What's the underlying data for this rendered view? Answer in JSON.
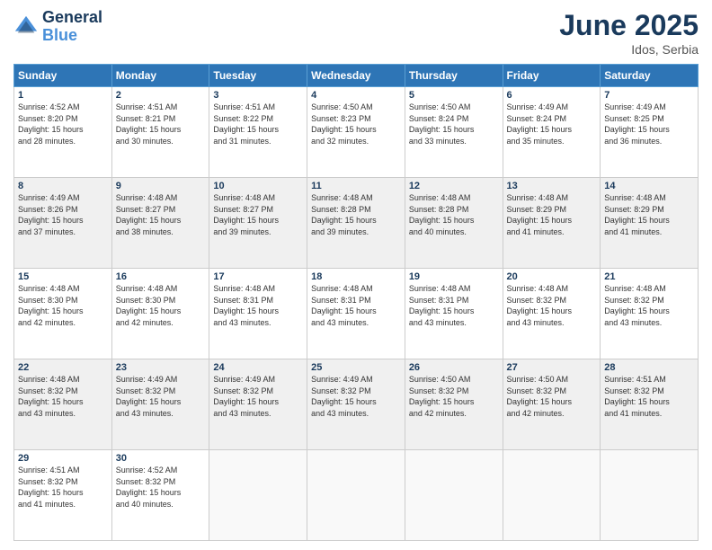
{
  "header": {
    "logo_line1": "General",
    "logo_line2": "Blue",
    "month_title": "June 2025",
    "location": "Idos, Serbia"
  },
  "days_of_week": [
    "Sunday",
    "Monday",
    "Tuesday",
    "Wednesday",
    "Thursday",
    "Friday",
    "Saturday"
  ],
  "weeks": [
    [
      {
        "day": "1",
        "info": "Sunrise: 4:52 AM\nSunset: 8:20 PM\nDaylight: 15 hours\nand 28 minutes."
      },
      {
        "day": "2",
        "info": "Sunrise: 4:51 AM\nSunset: 8:21 PM\nDaylight: 15 hours\nand 30 minutes."
      },
      {
        "day": "3",
        "info": "Sunrise: 4:51 AM\nSunset: 8:22 PM\nDaylight: 15 hours\nand 31 minutes."
      },
      {
        "day": "4",
        "info": "Sunrise: 4:50 AM\nSunset: 8:23 PM\nDaylight: 15 hours\nand 32 minutes."
      },
      {
        "day": "5",
        "info": "Sunrise: 4:50 AM\nSunset: 8:24 PM\nDaylight: 15 hours\nand 33 minutes."
      },
      {
        "day": "6",
        "info": "Sunrise: 4:49 AM\nSunset: 8:24 PM\nDaylight: 15 hours\nand 35 minutes."
      },
      {
        "day": "7",
        "info": "Sunrise: 4:49 AM\nSunset: 8:25 PM\nDaylight: 15 hours\nand 36 minutes."
      }
    ],
    [
      {
        "day": "8",
        "info": "Sunrise: 4:49 AM\nSunset: 8:26 PM\nDaylight: 15 hours\nand 37 minutes."
      },
      {
        "day": "9",
        "info": "Sunrise: 4:48 AM\nSunset: 8:27 PM\nDaylight: 15 hours\nand 38 minutes."
      },
      {
        "day": "10",
        "info": "Sunrise: 4:48 AM\nSunset: 8:27 PM\nDaylight: 15 hours\nand 39 minutes."
      },
      {
        "day": "11",
        "info": "Sunrise: 4:48 AM\nSunset: 8:28 PM\nDaylight: 15 hours\nand 39 minutes."
      },
      {
        "day": "12",
        "info": "Sunrise: 4:48 AM\nSunset: 8:28 PM\nDaylight: 15 hours\nand 40 minutes."
      },
      {
        "day": "13",
        "info": "Sunrise: 4:48 AM\nSunset: 8:29 PM\nDaylight: 15 hours\nand 41 minutes."
      },
      {
        "day": "14",
        "info": "Sunrise: 4:48 AM\nSunset: 8:29 PM\nDaylight: 15 hours\nand 41 minutes."
      }
    ],
    [
      {
        "day": "15",
        "info": "Sunrise: 4:48 AM\nSunset: 8:30 PM\nDaylight: 15 hours\nand 42 minutes."
      },
      {
        "day": "16",
        "info": "Sunrise: 4:48 AM\nSunset: 8:30 PM\nDaylight: 15 hours\nand 42 minutes."
      },
      {
        "day": "17",
        "info": "Sunrise: 4:48 AM\nSunset: 8:31 PM\nDaylight: 15 hours\nand 43 minutes."
      },
      {
        "day": "18",
        "info": "Sunrise: 4:48 AM\nSunset: 8:31 PM\nDaylight: 15 hours\nand 43 minutes."
      },
      {
        "day": "19",
        "info": "Sunrise: 4:48 AM\nSunset: 8:31 PM\nDaylight: 15 hours\nand 43 minutes."
      },
      {
        "day": "20",
        "info": "Sunrise: 4:48 AM\nSunset: 8:32 PM\nDaylight: 15 hours\nand 43 minutes."
      },
      {
        "day": "21",
        "info": "Sunrise: 4:48 AM\nSunset: 8:32 PM\nDaylight: 15 hours\nand 43 minutes."
      }
    ],
    [
      {
        "day": "22",
        "info": "Sunrise: 4:48 AM\nSunset: 8:32 PM\nDaylight: 15 hours\nand 43 minutes."
      },
      {
        "day": "23",
        "info": "Sunrise: 4:49 AM\nSunset: 8:32 PM\nDaylight: 15 hours\nand 43 minutes."
      },
      {
        "day": "24",
        "info": "Sunrise: 4:49 AM\nSunset: 8:32 PM\nDaylight: 15 hours\nand 43 minutes."
      },
      {
        "day": "25",
        "info": "Sunrise: 4:49 AM\nSunset: 8:32 PM\nDaylight: 15 hours\nand 43 minutes."
      },
      {
        "day": "26",
        "info": "Sunrise: 4:50 AM\nSunset: 8:32 PM\nDaylight: 15 hours\nand 42 minutes."
      },
      {
        "day": "27",
        "info": "Sunrise: 4:50 AM\nSunset: 8:32 PM\nDaylight: 15 hours\nand 42 minutes."
      },
      {
        "day": "28",
        "info": "Sunrise: 4:51 AM\nSunset: 8:32 PM\nDaylight: 15 hours\nand 41 minutes."
      }
    ],
    [
      {
        "day": "29",
        "info": "Sunrise: 4:51 AM\nSunset: 8:32 PM\nDaylight: 15 hours\nand 41 minutes."
      },
      {
        "day": "30",
        "info": "Sunrise: 4:52 AM\nSunset: 8:32 PM\nDaylight: 15 hours\nand 40 minutes."
      },
      {
        "day": "",
        "info": ""
      },
      {
        "day": "",
        "info": ""
      },
      {
        "day": "",
        "info": ""
      },
      {
        "day": "",
        "info": ""
      },
      {
        "day": "",
        "info": ""
      }
    ]
  ]
}
